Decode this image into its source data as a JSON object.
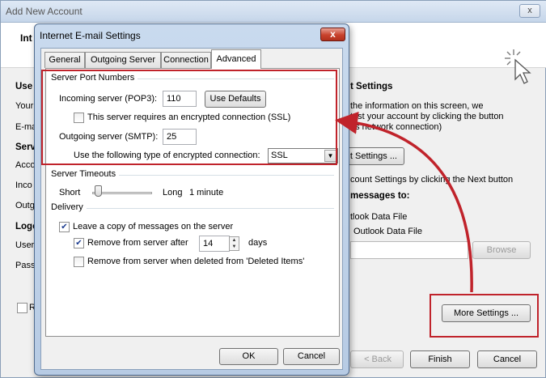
{
  "background": {
    "window_title": "Add New Account",
    "close_glyph": "x",
    "header_title": "Int",
    "left_labels": {
      "user_info": "Use",
      "your_name": "Your",
      "email": "E-ma",
      "server_info": "Serv",
      "account_type": "Acco",
      "incoming": "Inco",
      "outgoing": "Outg",
      "logon_info": "Logo",
      "user_name": "User",
      "password": "Pass",
      "remember_partial": "R"
    },
    "right_panel": {
      "heading": "t Settings",
      "line1": "the information on this screen, we",
      "line2": "test your account by clicking the button",
      "line3": "es network connection)",
      "test_button": "t Settings ...",
      "next_text": "count Settings by clicking the Next button",
      "deliver_heading": "messages to:",
      "opt1": "tlook Data File",
      "opt2": "Outlook Data File",
      "browse": "Browse",
      "more_settings": "More Settings ..."
    },
    "footer": {
      "back": "< Back",
      "finish": "Finish",
      "cancel": "Cancel"
    }
  },
  "dialog": {
    "title": "Internet E-mail Settings",
    "close_glyph": "x",
    "tabs": [
      "General",
      "Outgoing Server",
      "Connection",
      "Advanced"
    ],
    "active_tab": "Advanced",
    "server_ports": {
      "group_label": "Server Port Numbers",
      "incoming_label": "Incoming server (POP3):",
      "incoming_value": "110",
      "use_defaults": "Use Defaults",
      "ssl_incoming_label": "This server requires an encrypted connection (SSL)",
      "ssl_incoming_checked": false,
      "outgoing_label": "Outgoing server (SMTP):",
      "outgoing_value": "25",
      "encryption_label": "Use the following type of encrypted connection:",
      "encryption_value": "SSL"
    },
    "timeouts": {
      "group_label": "Server Timeouts",
      "short": "Short",
      "long": "Long",
      "value": "1 minute",
      "level": 0.05
    },
    "delivery": {
      "group_label": "Delivery",
      "leave_copy": "Leave a copy of messages on the server",
      "leave_copy_checked": true,
      "remove_after": "Remove from server after",
      "remove_after_checked": true,
      "days_value": "14",
      "days_unit": "days",
      "remove_deleted": "Remove from server when deleted from 'Deleted Items'",
      "remove_deleted_checked": false
    },
    "ok": "OK",
    "cancel": "Cancel"
  },
  "colors": {
    "highlight": "#c0232b",
    "dialog_frame": "#b7cbe4"
  }
}
